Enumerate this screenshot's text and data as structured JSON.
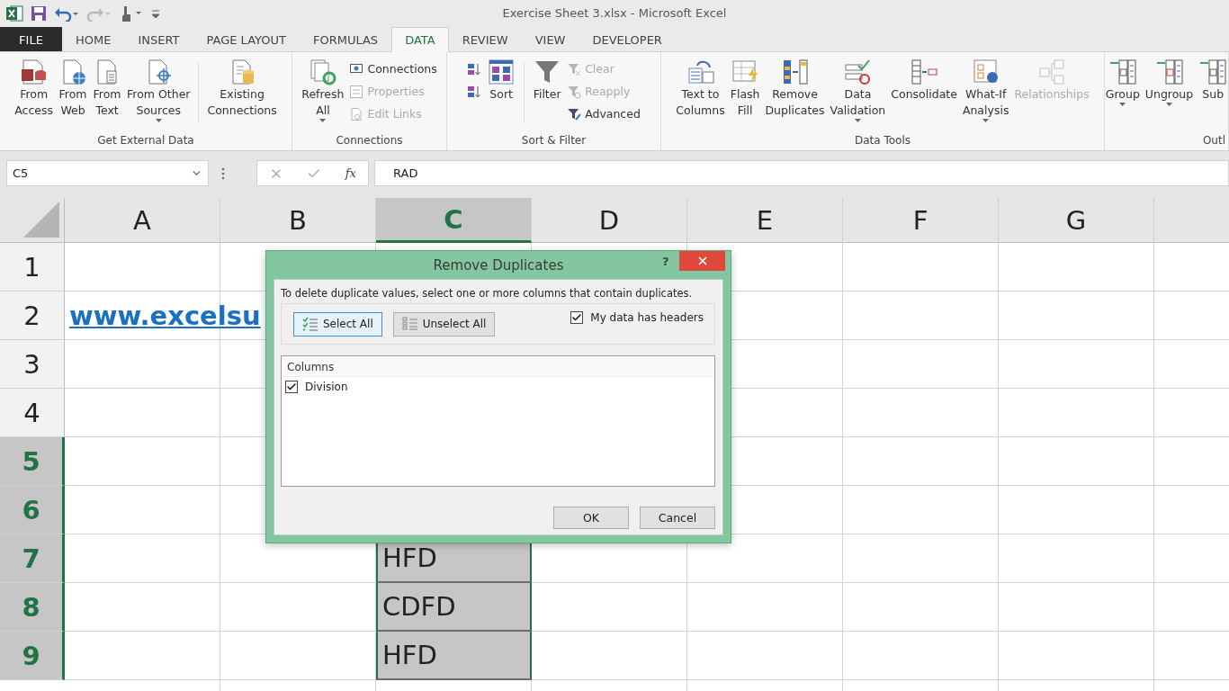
{
  "window": {
    "title": "Exercise Sheet 3.xlsx - Microsoft Excel"
  },
  "tabs": [
    {
      "label": "FILE",
      "kind": "file",
      "selected": false
    },
    {
      "label": "HOME",
      "kind": "tab",
      "selected": false
    },
    {
      "label": "INSERT",
      "kind": "tab",
      "selected": false
    },
    {
      "label": "PAGE LAYOUT",
      "kind": "tab",
      "selected": false
    },
    {
      "label": "FORMULAS",
      "kind": "tab",
      "selected": false
    },
    {
      "label": "DATA",
      "kind": "tab",
      "selected": true
    },
    {
      "label": "REVIEW",
      "kind": "tab",
      "selected": false
    },
    {
      "label": "VIEW",
      "kind": "tab",
      "selected": false
    },
    {
      "label": "DEVELOPER",
      "kind": "tab",
      "selected": false
    }
  ],
  "ribbon": {
    "groups": [
      {
        "label": "Get External Data",
        "items": [
          {
            "kind": "large",
            "lines": [
              "From",
              "Access"
            ]
          },
          {
            "kind": "large",
            "lines": [
              "From",
              "Web"
            ]
          },
          {
            "kind": "large",
            "lines": [
              "From",
              "Text"
            ]
          },
          {
            "kind": "large",
            "lines": [
              "From Other",
              "Sources"
            ],
            "menu": true
          },
          {
            "kind": "separator"
          },
          {
            "kind": "large",
            "lines": [
              "Existing",
              "Connections"
            ]
          }
        ]
      },
      {
        "label": "Connections",
        "items": [
          {
            "kind": "large",
            "lines": [
              "Refresh",
              "All"
            ],
            "menu": true
          },
          {
            "kind": "stack",
            "items": [
              {
                "label": "Connections",
                "disabled": false
              },
              {
                "label": "Properties",
                "disabled": true
              },
              {
                "label": "Edit Links",
                "disabled": true
              }
            ]
          }
        ]
      },
      {
        "label": "Sort & Filter",
        "items": [
          {
            "kind": "stack",
            "items": [
              {
                "kind": "ascending"
              },
              {
                "kind": "descending"
              }
            ]
          },
          {
            "kind": "large",
            "lines": [
              "Sort"
            ]
          },
          {
            "kind": "separator"
          },
          {
            "kind": "large",
            "lines": [
              "Filter"
            ]
          },
          {
            "kind": "stack",
            "items": [
              {
                "label": "Clear",
                "disabled": true
              },
              {
                "label": "Reapply",
                "disabled": true
              },
              {
                "label": "Advanced",
                "disabled": false
              }
            ]
          }
        ]
      },
      {
        "label": "Data Tools",
        "items": [
          {
            "kind": "large",
            "lines": [
              "Text to",
              "Columns"
            ]
          },
          {
            "kind": "large",
            "lines": [
              "Flash",
              "Fill"
            ]
          },
          {
            "kind": "large",
            "lines": [
              "Remove",
              "Duplicates"
            ]
          },
          {
            "kind": "large",
            "lines": [
              "Data",
              "Validation"
            ],
            "menu": true
          },
          {
            "kind": "large",
            "lines": [
              "Consolidate"
            ]
          },
          {
            "kind": "large",
            "lines": [
              "What-If",
              "Analysis"
            ],
            "menu": true
          },
          {
            "kind": "large",
            "lines": [
              "Relationships"
            ],
            "disabled": true
          }
        ]
      },
      {
        "label": "Outl",
        "items": [
          {
            "kind": "large",
            "lines": [
              "Group"
            ],
            "menu": true
          },
          {
            "kind": "large",
            "lines": [
              "Ungroup"
            ],
            "menu": true
          },
          {
            "kind": "large",
            "lines": [
              "Sub"
            ]
          }
        ]
      }
    ]
  },
  "formula_bar": {
    "name_box": "C5",
    "fx": "fx",
    "formula": "RAD"
  },
  "sheet": {
    "columns": [
      {
        "label": "A",
        "selected": false
      },
      {
        "label": "B",
        "selected": false
      },
      {
        "label": "C",
        "selected": true
      },
      {
        "label": "D",
        "selected": false
      },
      {
        "label": "E",
        "selected": false
      },
      {
        "label": "F",
        "selected": false
      },
      {
        "label": "G",
        "selected": false
      },
      {
        "selected": false
      }
    ],
    "rows": [
      {
        "label": "1",
        "selected": false,
        "cells": [
          {},
          {},
          {},
          {},
          {},
          {},
          {},
          {}
        ]
      },
      {
        "label": "2",
        "selected": false,
        "cells": [
          {
            "text": "www.excelsu",
            "kind": "link"
          },
          {},
          {},
          {},
          {},
          {},
          {},
          {}
        ]
      },
      {
        "label": "3",
        "selected": false,
        "cells": [
          {},
          {},
          {},
          {},
          {},
          {},
          {},
          {}
        ]
      },
      {
        "label": "4",
        "selected": false,
        "cells": [
          {},
          {},
          {},
          {},
          {},
          {},
          {},
          {}
        ]
      },
      {
        "label": "5",
        "selected": true,
        "cells": [
          {},
          {},
          {},
          {},
          {},
          {},
          {},
          {}
        ]
      },
      {
        "label": "6",
        "selected": true,
        "cells": [
          {},
          {},
          {},
          {},
          {},
          {},
          {},
          {}
        ]
      },
      {
        "label": "7",
        "selected": true,
        "cells": [
          {},
          {},
          {
            "text": "HFD",
            "kind": "text"
          },
          {},
          {},
          {},
          {},
          {}
        ]
      },
      {
        "label": "8",
        "selected": true,
        "cells": [
          {},
          {},
          {
            "text": "CDFD",
            "kind": "text"
          },
          {},
          {},
          {},
          {},
          {}
        ]
      },
      {
        "label": "9",
        "selected": true,
        "cells": [
          {},
          {},
          {
            "text": "HFD",
            "kind": "text"
          },
          {},
          {},
          {},
          {},
          {}
        ]
      }
    ]
  },
  "dialog": {
    "title": "Remove Duplicates",
    "help": "?",
    "instruction": "To delete duplicate values, select one or more columns that contain duplicates.",
    "select_all": "Select All",
    "unselect_all": "Unselect All",
    "headers_checkbox": {
      "label": "My data has headers",
      "checked": true
    },
    "list_header": "Columns",
    "columns": [
      {
        "label": "Division",
        "checked": true
      }
    ],
    "buttons": [
      "OK",
      "Cancel"
    ]
  }
}
